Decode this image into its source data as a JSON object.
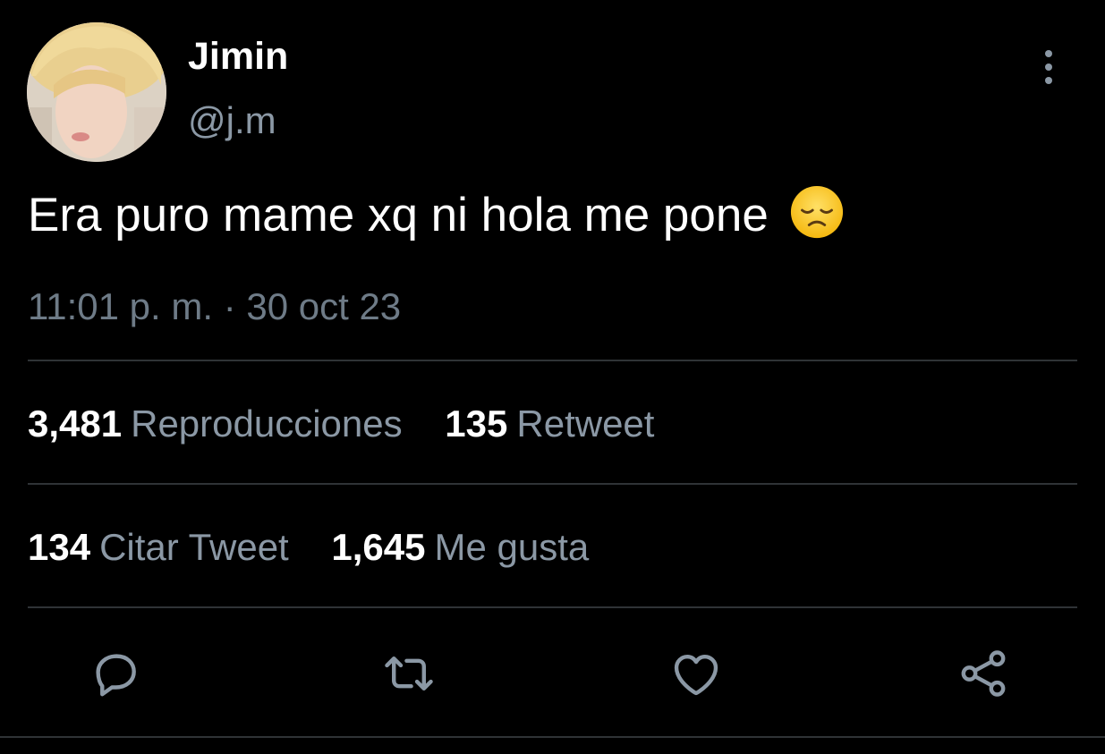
{
  "author": {
    "display_name": "Jimin",
    "handle": "@j.m"
  },
  "tweet": {
    "text": "Era puro mame xq ni hola me pone",
    "emoji": "disappointed-face",
    "time": "11:01 p. m.",
    "separator": "·",
    "date": "30 oct 23"
  },
  "stats": {
    "views": {
      "count": "3,481",
      "label": "Reproducciones"
    },
    "retweets": {
      "count": "135",
      "label": "Retweet"
    },
    "quotes": {
      "count": "134",
      "label": "Citar Tweet"
    },
    "likes": {
      "count": "1,645",
      "label": "Me gusta"
    }
  },
  "actions": {
    "icons": [
      "reply-icon",
      "retweet-icon",
      "like-icon",
      "share-icon"
    ]
  },
  "colors": {
    "background": "#000000",
    "primary_text": "#ffffff",
    "secondary_text": "#8b98a5",
    "divider": "#2f3336"
  }
}
